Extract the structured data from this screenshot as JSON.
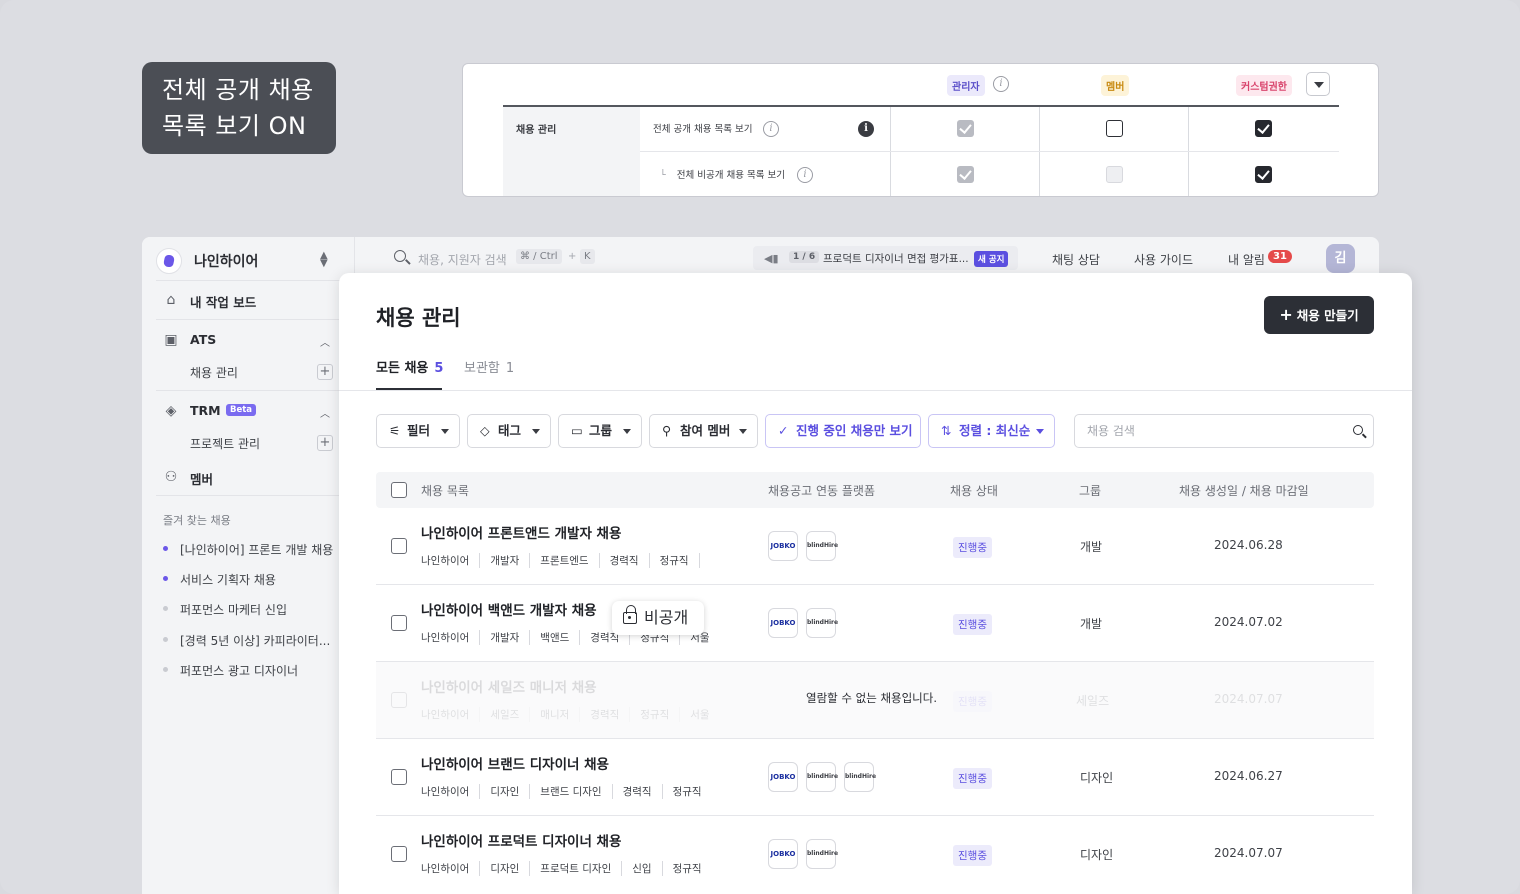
{
  "callout": {
    "line1": "전체 공개 채용",
    "line2": "목록 보기 ON"
  },
  "permissions": {
    "roles": {
      "admin": "관리자",
      "member": "멤버",
      "custom": "커스텀권한"
    },
    "section": "채용 관리",
    "rows": [
      {
        "label": "전체 공개 채용 목록 보기",
        "admin": "checked-disabled",
        "member": "unchecked",
        "custom": "checked"
      },
      {
        "label": "전체 비공개 채용 목록 보기",
        "admin": "checked-disabled",
        "member": "disabled",
        "custom": "checked"
      }
    ]
  },
  "workspace": {
    "name": "나인하이어"
  },
  "sidebar": {
    "home": "내 작업 보드",
    "ats": {
      "label": "ATS",
      "sub": "채용 관리"
    },
    "trm": {
      "label": "TRM",
      "badge": "Beta",
      "sub": "프로젝트 관리"
    },
    "members": "멤버",
    "favorites_title": "즐겨 찾는 채용",
    "favorites": [
      {
        "label": "[나인하이어] 프론트 개발 채용",
        "color": "#6b57e8"
      },
      {
        "label": "서비스 기획자 채용",
        "color": "#6b57e8"
      },
      {
        "label": "퍼포먼스 마케터 신입",
        "color": "#c9cbd1"
      },
      {
        "label": "[경력 5년 이상] 카피라이터...",
        "color": "#c9cbd1"
      },
      {
        "label": "퍼포먼스 광고 디자이너",
        "color": "#c9cbd1"
      }
    ]
  },
  "topbar": {
    "search_placeholder": "채용, 지원자 검색",
    "shortcut1": "⌘ / Ctrl",
    "shortcut_plus": "+",
    "shortcut2": "K",
    "announcement": {
      "count": "1 / 6",
      "text": "프로덕트 디자이너 면접 평가표...",
      "badge": "새 공지"
    },
    "chat": "채팅 상담",
    "guide": "사용 가이드",
    "notifications": "내 알림",
    "notif_count": "31",
    "avatar": "김"
  },
  "main": {
    "title": "채용 관리",
    "create_button": "채용 만들기",
    "tabs": [
      {
        "label": "모든 채용",
        "count": "5"
      },
      {
        "label": "보관함",
        "count": "1"
      }
    ],
    "filters": {
      "filter": "필터",
      "tag": "태그",
      "group": "그룹",
      "participants": "참여 멤버",
      "in_progress_only": "진행 중인 채용만 보기",
      "sort": "정렬 : 최신순",
      "search_placeholder": "채용 검색"
    },
    "columns": [
      "채용 목록",
      "채용공고 연동 플랫폼",
      "채용 상태",
      "그룹",
      "채용 생성일 / 채용 마감일"
    ],
    "rows": [
      {
        "title": "나인하이어 프론트앤드 개발자 채용",
        "tags": [
          "나인하이어",
          "개발자",
          "프론트엔드",
          "경력직",
          "정규직",
          ""
        ],
        "platforms": [
          "JOBKO",
          "blindHire"
        ],
        "status": "진행중",
        "group": "개발",
        "date": "2024.06.28"
      },
      {
        "title": "나인하이어 백앤드 개발자 채용",
        "tags": [
          "나인하이어",
          "개발자",
          "백앤드",
          "경력직",
          "정규직",
          "서울"
        ],
        "platforms": [
          "JOBKO",
          "blindHire"
        ],
        "status": "진행중",
        "group": "개발",
        "date": "2024.07.02"
      },
      {
        "title": "나인하이어 세일즈 매니저 채용",
        "tags": [
          "나인하이어",
          "세일즈",
          "매니저",
          "경력직",
          "정규직",
          "서울"
        ],
        "platforms": [],
        "status": "진행중",
        "group": "세일즈",
        "date": "2024.07.07",
        "locked_message": "열람할 수 없는 채용입니다."
      },
      {
        "title": "나인하이어 브랜드 디자이너 채용",
        "tags": [
          "나인하이어",
          "디자인",
          "브랜드 디자인",
          "경력직",
          "정규직"
        ],
        "platforms": [
          "JOBKO",
          "blindHire",
          "blindHire"
        ],
        "status": "진행중",
        "group": "디자인",
        "date": "2024.06.27"
      },
      {
        "title": "나인하이어 프로덕트 디자이너 채용",
        "tags": [
          "나인하이어",
          "디자인",
          "프로덕트 디자인",
          "신입",
          "정규직"
        ],
        "platforms": [
          "JOBKO",
          "blindHire"
        ],
        "status": "진행중",
        "group": "디자인",
        "date": "2024.07.07"
      }
    ],
    "private_tooltip": "비공개"
  }
}
